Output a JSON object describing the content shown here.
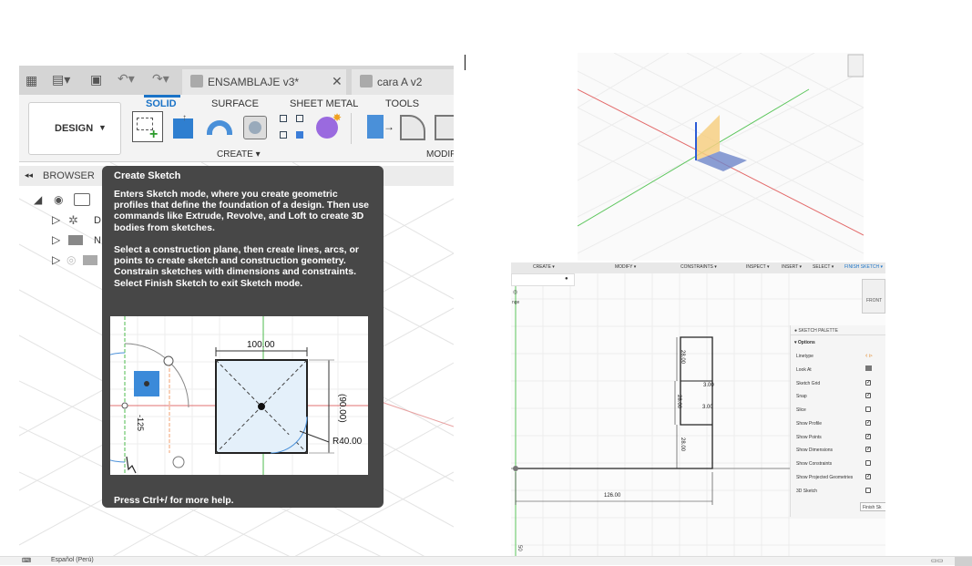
{
  "tabs": [
    {
      "label": "ENSAMBLAJE v3*"
    },
    {
      "label": "cara A v2"
    }
  ],
  "workspace": {
    "label": "DESIGN"
  },
  "ribbon_tabs": [
    "SOLID",
    "SURFACE",
    "SHEET METAL",
    "TOOLS"
  ],
  "groups": {
    "create": "CREATE",
    "modify": "MODIF"
  },
  "browser": {
    "label": "BROWSER",
    "rows": [
      "D",
      "N"
    ]
  },
  "tooltip": {
    "title": "Create Sketch",
    "p1": "Enters Sketch mode, where you create geometric profiles that define the foundation of a design. Then use commands like Extrude, Revolve, and Loft to create 3D bodies from sketches.",
    "p2": "Select a construction plane, then create lines, arcs, or points to create sketch and construction geometry. Constrain sketches with dimensions and constraints. Select Finish Sketch to exit Sketch mode.",
    "footer": "Press Ctrl+/ for more help.",
    "dims": {
      "width": "100.00",
      "height": "(90.00)",
      "radius": "R40.00",
      "neg": "-125"
    }
  },
  "sketch": {
    "toolbar": [
      "CREATE ▾",
      "MODIFY ▾",
      "CONSTRAINTS ▾",
      "INSPECT ▾",
      "INSERT ▾",
      "SELECT ▾",
      "FINISH SKETCH ▾"
    ],
    "front_label": "FRONT",
    "nge_label": "nge",
    "dims": [
      "28.00",
      "28.00",
      "28.00",
      "3.00",
      "3.00",
      "126.00"
    ],
    "axis_label": "50"
  },
  "palette": {
    "title": "SKETCH PALETTE",
    "section": "Options",
    "rows": [
      {
        "label": "Linetype",
        "state": "icon"
      },
      {
        "label": "Look At",
        "state": "icon"
      },
      {
        "label": "Sketch Grid",
        "state": "checked"
      },
      {
        "label": "Snap",
        "state": "checked"
      },
      {
        "label": "Slice",
        "state": "unchecked"
      },
      {
        "label": "Show Profile",
        "state": "checked"
      },
      {
        "label": "Show Points",
        "state": "checked"
      },
      {
        "label": "Show Dimensions",
        "state": "checked"
      },
      {
        "label": "Show Constraints",
        "state": "unchecked"
      },
      {
        "label": "Show Projected Geometries",
        "state": "checked"
      },
      {
        "label": "3D Sketch",
        "state": "unchecked"
      }
    ],
    "finish": "Finish Sk"
  },
  "status": {
    "text": "Español (Perú)"
  }
}
